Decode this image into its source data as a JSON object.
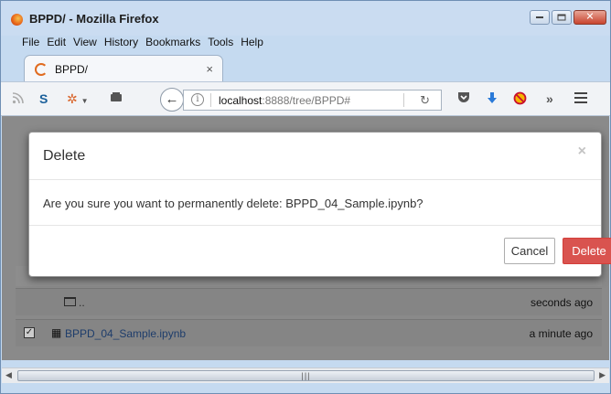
{
  "window": {
    "title": "BPPD/ - Mozilla Firefox",
    "controls": {
      "minimize": "minimize",
      "maximize": "maximize",
      "close": "✕"
    }
  },
  "menu": [
    "File",
    "Edit",
    "View",
    "History",
    "Bookmarks",
    "Tools",
    "Help"
  ],
  "tab": {
    "title": "BPPD/",
    "close": "×"
  },
  "toolbar": {
    "url_host": "localhost",
    "url_rest": ":8888/tree/BPPD#",
    "icons": [
      "rss-icon",
      "skype-icon",
      "addon-icon",
      "reader-icon",
      "pocket-icon",
      "download-icon",
      "blocker-icon",
      "overflow-icon",
      "menu-icon"
    ]
  },
  "notebook": {
    "rows": [
      {
        "name": "..",
        "time": "seconds ago"
      },
      {
        "name": "BPPD_04_Sample.ipynb",
        "time": "a minute ago",
        "checked": true
      }
    ]
  },
  "dialog": {
    "title": "Delete",
    "close": "×",
    "message": "Are you sure you want to permanently delete: BPPD_04_Sample.ipynb?",
    "cancel_label": "Cancel",
    "delete_label": "Delete"
  },
  "colors": {
    "delete_button": "#d9534f",
    "overlay": "#808080",
    "titlebar": "#cadcf1"
  }
}
